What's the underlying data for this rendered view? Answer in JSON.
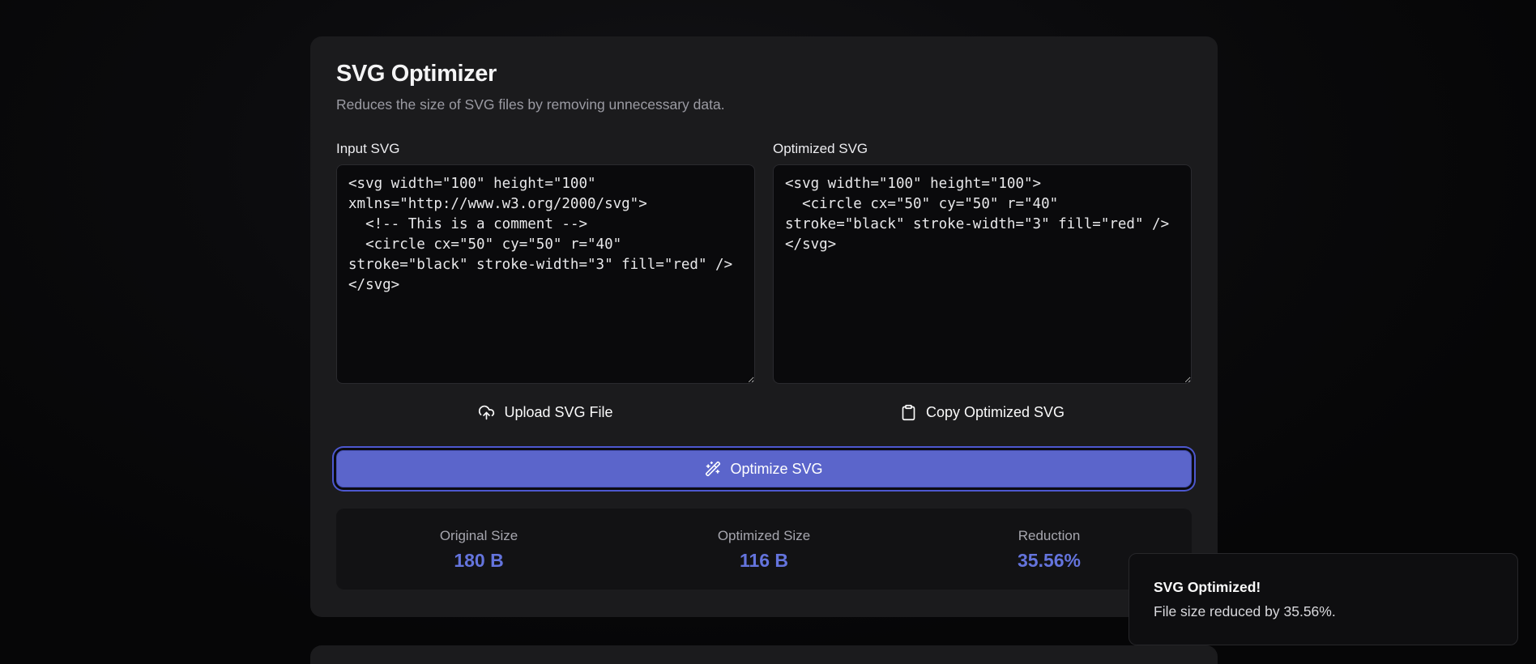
{
  "card": {
    "title": "SVG Optimizer",
    "subtitle": "Reduces the size of SVG files by removing unnecessary data.",
    "input": {
      "label": "Input SVG",
      "value": "<svg width=\"100\" height=\"100\" xmlns=\"http://www.w3.org/2000/svg\">\n  <!-- This is a comment -->\n  <circle cx=\"50\" cy=\"50\" r=\"40\" stroke=\"black\" stroke-width=\"3\" fill=\"red\" />\n</svg>",
      "upload_button_label": "Upload SVG File",
      "upload_icon": "cloud-upload-icon"
    },
    "output": {
      "label": "Optimized SVG",
      "value": "<svg width=\"100\" height=\"100\">\n  <circle cx=\"50\" cy=\"50\" r=\"40\" stroke=\"black\" stroke-width=\"3\" fill=\"red\" />\n</svg>",
      "copy_button_label": "Copy Optimized SVG",
      "copy_icon": "clipboard-icon"
    },
    "optimize_button_label": "Optimize SVG",
    "optimize_icon": "wand-sparkles-icon",
    "stats": [
      {
        "label": "Original Size",
        "value": "180 B"
      },
      {
        "label": "Optimized Size",
        "value": "116 B"
      },
      {
        "label": "Reduction",
        "value": "35.56%"
      }
    ]
  },
  "toast": {
    "title": "SVG Optimized!",
    "message": "File size reduced by 35.56%."
  },
  "colors": {
    "accent_button": "#5b65cb",
    "accent_ring": "#4d58cf",
    "stat_value": "#6474dd",
    "card_background": "#1b1b1d",
    "page_background": "#0a0a0b",
    "code_background": "#0a0a0c"
  }
}
